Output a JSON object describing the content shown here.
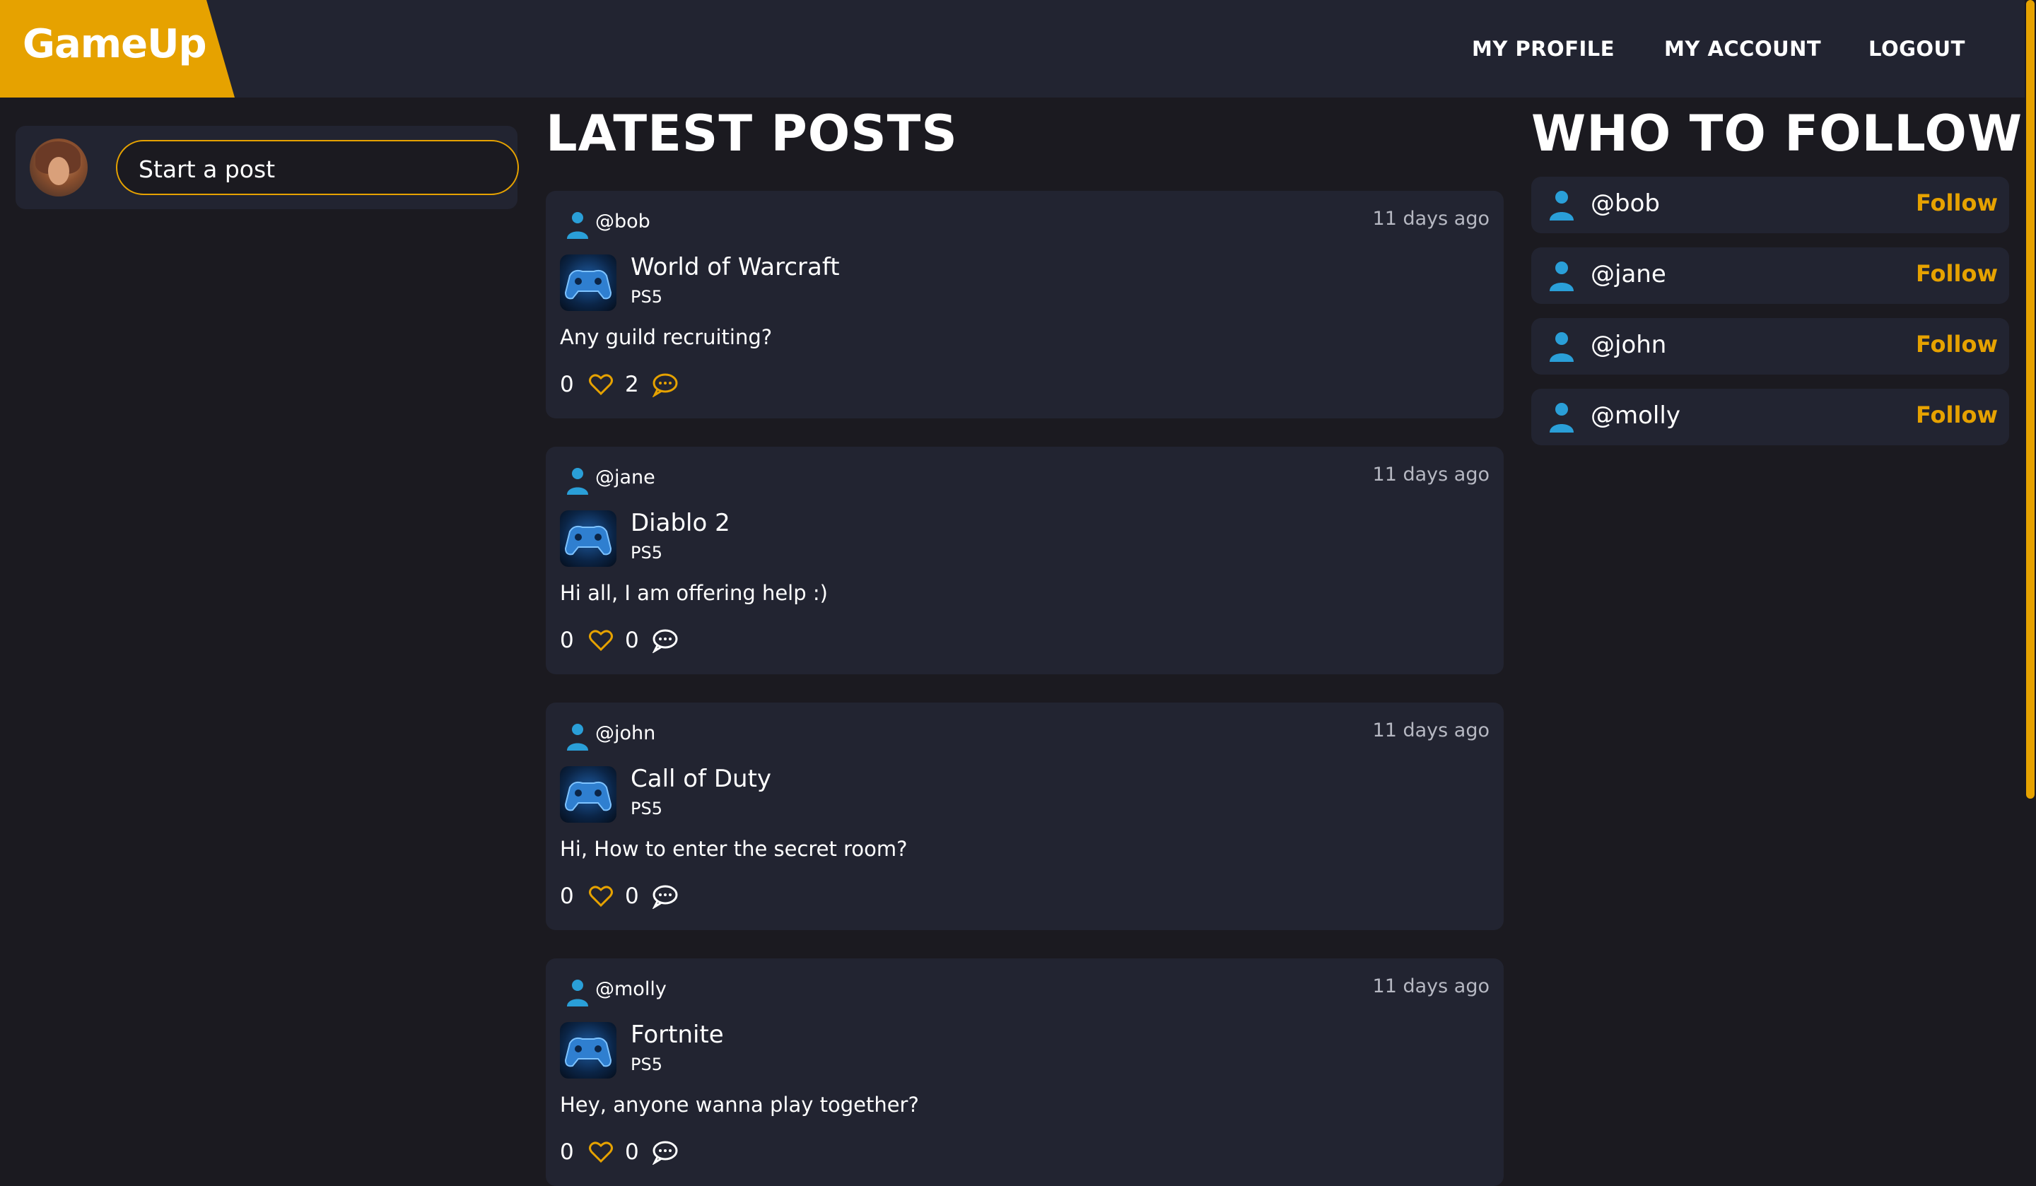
{
  "app": {
    "name": "GameUp"
  },
  "nav": {
    "links": [
      {
        "label": "MY PROFILE"
      },
      {
        "label": "MY ACCOUNT"
      },
      {
        "label": "LOGOUT"
      }
    ]
  },
  "composer": {
    "placeholder": "Start a post"
  },
  "latest": {
    "title": "LATEST POSTS",
    "posts": [
      {
        "user": "@bob",
        "time": "11 days ago",
        "game": "World of Warcraft",
        "platform": "PS5",
        "text": "Any guild recruiting?",
        "likes": "0",
        "comments": "2",
        "commented": true
      },
      {
        "user": "@jane",
        "time": "11 days ago",
        "game": "Diablo 2",
        "platform": "PS5",
        "text": "Hi all, I am offering help :)",
        "likes": "0",
        "comments": "0",
        "commented": false
      },
      {
        "user": "@john",
        "time": "11 days ago",
        "game": "Call of Duty",
        "platform": "PS5",
        "text": "Hi, How to enter the secret room?",
        "likes": "0",
        "comments": "0",
        "commented": false
      },
      {
        "user": "@molly",
        "time": "11 days ago",
        "game": "Fortnite",
        "platform": "PS5",
        "text": "Hey, anyone wanna play together?",
        "likes": "0",
        "comments": "0",
        "commented": false
      }
    ]
  },
  "follow": {
    "title": "WHO TO FOLLOW",
    "button_label": "Follow",
    "users": [
      "@bob",
      "@jane",
      "@john",
      "@molly"
    ]
  },
  "colors": {
    "accent": "#e6a200",
    "background": "#1b1a20",
    "card": "#222431",
    "user_icon": "#2a9fd8",
    "muted": "#b6b8c2"
  }
}
